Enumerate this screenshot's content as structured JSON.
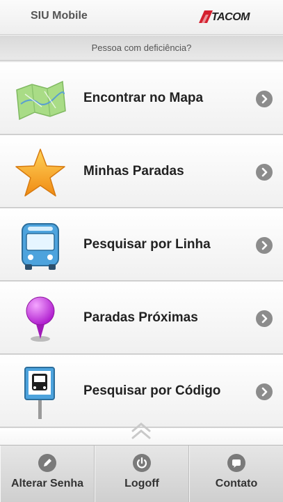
{
  "header": {
    "title": "SIU Mobile",
    "logo_text": "TACOM"
  },
  "subheader": {
    "link": "Pessoa com deficiência?"
  },
  "menu": {
    "items": [
      {
        "label": "Encontrar no Mapa",
        "icon": "map-icon"
      },
      {
        "label": "Minhas Paradas",
        "icon": "star-icon"
      },
      {
        "label": "Pesquisar por Linha",
        "icon": "bus-icon"
      },
      {
        "label": "Paradas Próximas",
        "icon": "location-pin-icon"
      },
      {
        "label": "Pesquisar por Código",
        "icon": "bus-stop-sign-icon"
      }
    ]
  },
  "footer": {
    "buttons": [
      {
        "label": "Alterar Senha",
        "icon": "pencil-icon"
      },
      {
        "label": "Logoff",
        "icon": "power-icon"
      },
      {
        "label": "Contato",
        "icon": "chat-icon"
      }
    ]
  },
  "colors": {
    "star": "#f7a21b",
    "pin": "#c02bd8",
    "bus": "#4da3dd",
    "map": "#9fd67a",
    "logo_red": "#d4202f"
  }
}
